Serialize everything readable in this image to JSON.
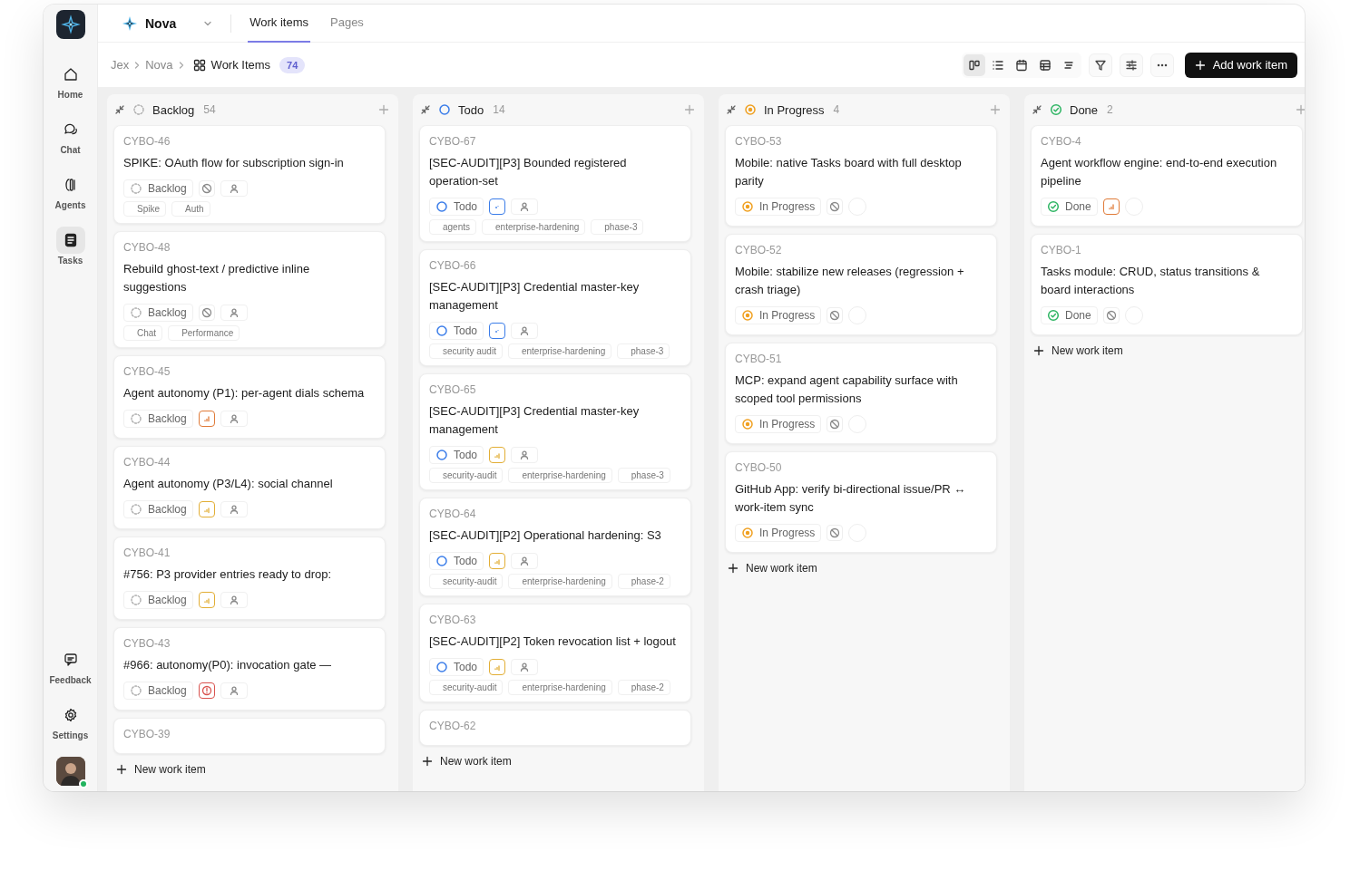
{
  "sidebar": {
    "items": [
      {
        "label": "Home",
        "selected": false
      },
      {
        "label": "Chat",
        "selected": false
      },
      {
        "label": "Agents",
        "selected": false
      },
      {
        "label": "Tasks",
        "selected": true
      }
    ],
    "bottom_items": [
      {
        "label": "Feedback"
      },
      {
        "label": "Settings"
      }
    ],
    "user": {
      "online": true
    }
  },
  "topbar": {
    "project": "Nova",
    "tabs": [
      {
        "label": "Work items",
        "selected": true
      },
      {
        "label": "Pages",
        "selected": false
      }
    ]
  },
  "breadcrumb": {
    "items": [
      "Jex",
      "Nova"
    ],
    "current": "Work Items",
    "count": "74"
  },
  "view_options": [
    {
      "selected": true
    },
    {
      "selected": false
    },
    {
      "selected": false
    },
    {
      "selected": false
    },
    {
      "selected": false
    }
  ],
  "add_button": "Add work item",
  "columns": [
    {
      "name": "Backlog",
      "status": {
        "kind": "backlog"
      },
      "count": "54",
      "footer": "New work item",
      "cards": [
        {
          "id": "CYBO-46",
          "title": "SPIKE: OAuth flow for subscription sign-in",
          "status": {
            "kind": "backlog",
            "label": "Backlog"
          },
          "priority": {
            "kind": "none"
          },
          "assignee": {
            "kind": "icon"
          },
          "labels": [
            "Spike",
            "Auth"
          ]
        },
        {
          "id": "CYBO-48",
          "title": "Rebuild ghost-text / predictive inline suggestions",
          "status": {
            "kind": "backlog",
            "label": "Backlog"
          },
          "priority": {
            "kind": "none"
          },
          "assignee": {
            "kind": "icon"
          },
          "labels": [
            "Chat",
            "Performance"
          ]
        },
        {
          "id": "CYBO-45",
          "title": "Agent autonomy (P1): per-agent dials schema",
          "status": {
            "kind": "backlog",
            "label": "Backlog"
          },
          "priority": {
            "kind": "high"
          },
          "assignee": {
            "kind": "icon"
          }
        },
        {
          "id": "CYBO-44",
          "title": "Agent autonomy (P3/L4): social channel",
          "status": {
            "kind": "backlog",
            "label": "Backlog"
          },
          "priority": {
            "kind": "medium"
          },
          "assignee": {
            "kind": "icon"
          }
        },
        {
          "id": "CYBO-41",
          "title": "#756: P3 provider entries ready to drop:",
          "status": {
            "kind": "backlog",
            "label": "Backlog"
          },
          "priority": {
            "kind": "medium"
          },
          "assignee": {
            "kind": "icon"
          }
        },
        {
          "id": "CYBO-43",
          "title": "#966: autonomy(P0): invocation gate —",
          "status": {
            "kind": "backlog",
            "label": "Backlog"
          },
          "priority": {
            "kind": "urgent"
          },
          "assignee": {
            "kind": "icon"
          }
        },
        {
          "id": "CYBO-39"
        }
      ]
    },
    {
      "name": "Todo",
      "status": {
        "kind": "todo"
      },
      "count": "14",
      "footer": "New work item",
      "cards": [
        {
          "id": "CYBO-67",
          "title": "[SEC-AUDIT][P3] Bounded registered operation-set",
          "status": {
            "kind": "todo",
            "label": "Todo"
          },
          "priority": {
            "kind": "low"
          },
          "assignee": {
            "kind": "icon"
          },
          "labels": [
            "agents",
            "enterprise-hardening",
            "phase-3"
          ]
        },
        {
          "id": "CYBO-66",
          "title": "[SEC-AUDIT][P3] Credential master-key management",
          "status": {
            "kind": "todo",
            "label": "Todo"
          },
          "priority": {
            "kind": "low"
          },
          "assignee": {
            "kind": "icon"
          },
          "labels": [
            "security audit",
            "enterprise-hardening",
            "phase-3"
          ]
        },
        {
          "id": "CYBO-65",
          "title": "[SEC-AUDIT][P3] Credential master-key management",
          "status": {
            "kind": "todo",
            "label": "Todo"
          },
          "priority": {
            "kind": "medium"
          },
          "assignee": {
            "kind": "icon"
          },
          "labels": [
            "security-audit",
            "enterprise-hardening",
            "phase-3"
          ]
        },
        {
          "id": "CYBO-64",
          "title": "[SEC-AUDIT][P2] Operational hardening: S3",
          "status": {
            "kind": "todo",
            "label": "Todo"
          },
          "priority": {
            "kind": "medium"
          },
          "assignee": {
            "kind": "icon"
          },
          "labels": [
            "security-audit",
            "enterprise-hardening",
            "phase-2"
          ]
        },
        {
          "id": "CYBO-63",
          "title": "[SEC-AUDIT][P2] Token revocation list + logout",
          "status": {
            "kind": "todo",
            "label": "Todo"
          },
          "priority": {
            "kind": "medium"
          },
          "assignee": {
            "kind": "icon"
          },
          "labels": [
            "security-audit",
            "enterprise-hardening",
            "phase-2"
          ]
        },
        {
          "id": "CYBO-62"
        }
      ]
    },
    {
      "name": "In Progress",
      "status": {
        "kind": "in_progress"
      },
      "count": "4",
      "footer": "New work item",
      "cards": [
        {
          "id": "CYBO-53",
          "title": "Mobile: native Tasks board with full desktop parity",
          "status": {
            "kind": "in_progress",
            "label": "In Progress"
          },
          "priority": {
            "kind": "none"
          },
          "assignee": {
            "kind": "circle"
          }
        },
        {
          "id": "CYBO-52",
          "title": "Mobile: stabilize new releases (regression + crash triage)",
          "status": {
            "kind": "in_progress",
            "label": "In Progress"
          },
          "priority": {
            "kind": "none"
          },
          "assignee": {
            "kind": "circle"
          }
        },
        {
          "id": "CYBO-51",
          "title": "MCP: expand agent capability surface with scoped tool permissions",
          "status": {
            "kind": "in_progress",
            "label": "In Progress"
          },
          "priority": {
            "kind": "none"
          },
          "assignee": {
            "kind": "circle"
          }
        },
        {
          "id": "CYBO-50",
          "title": "GitHub App: verify bi-directional issue/PR ↔ work-item sync",
          "status": {
            "kind": "in_progress",
            "label": "In Progress"
          },
          "priority": {
            "kind": "none"
          },
          "assignee": {
            "kind": "circle"
          }
        }
      ]
    },
    {
      "name": "Done",
      "status": {
        "kind": "done"
      },
      "count": "2",
      "footer": "New work item",
      "cards": [
        {
          "id": "CYBO-4",
          "title": "Agent workflow engine: end-to-end execution pipeline",
          "status": {
            "kind": "done",
            "label": "Done"
          },
          "priority": {
            "kind": "high"
          },
          "assignee": {
            "kind": "circle"
          }
        },
        {
          "id": "CYBO-1",
          "title": "Tasks module: CRUD, status transitions & board interactions",
          "status": {
            "kind": "done",
            "label": "Done"
          },
          "priority": {
            "kind": "none"
          },
          "assignee": {
            "kind": "circle"
          }
        }
      ]
    }
  ]
}
